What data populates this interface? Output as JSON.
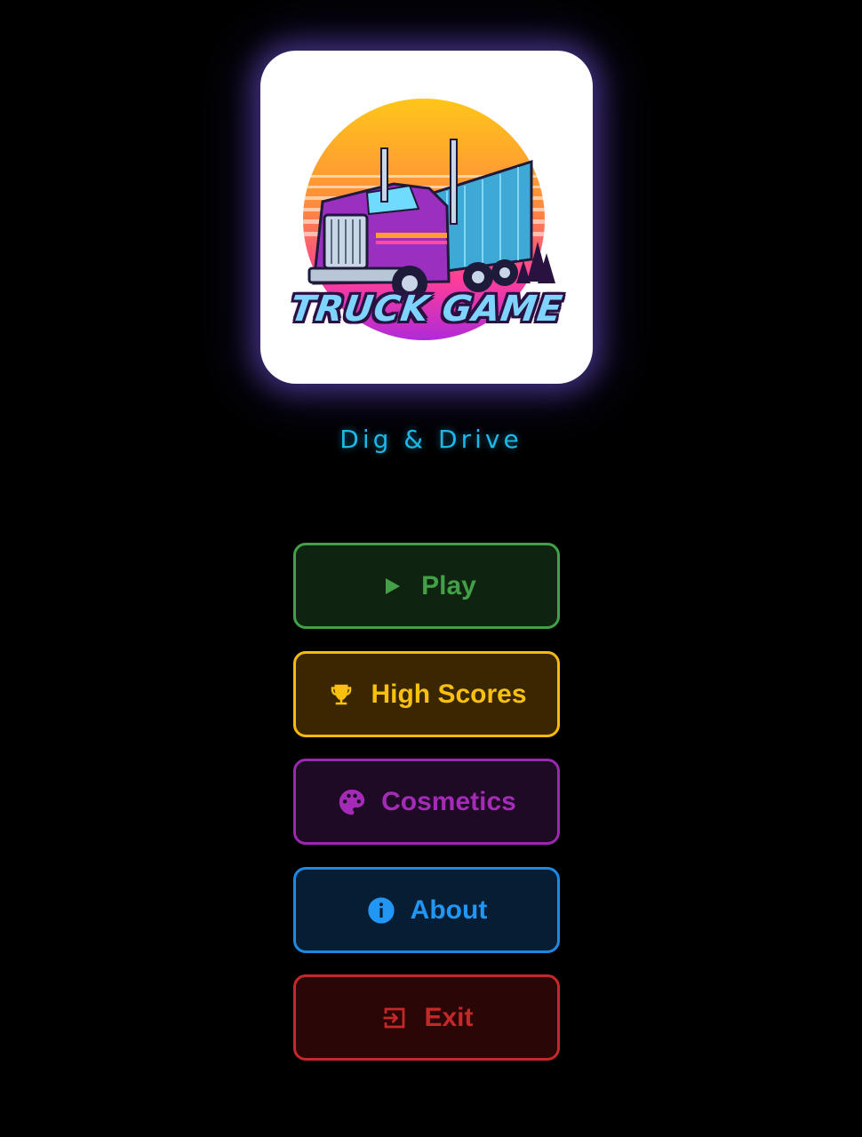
{
  "logo": {
    "title": "TRUCK GAME"
  },
  "subtitle": "Dig & Drive",
  "menu": {
    "play": {
      "label": "Play",
      "icon": "play-icon",
      "color": "#43a047"
    },
    "high_scores": {
      "label": "High Scores",
      "icon": "trophy-icon",
      "color": "#f9c00f"
    },
    "cosmetics": {
      "label": "Cosmetics",
      "icon": "palette-icon",
      "color": "#a62ab8"
    },
    "about": {
      "label": "About",
      "icon": "info-icon",
      "color": "#2196f3"
    },
    "exit": {
      "label": "Exit",
      "icon": "exit-icon",
      "color": "#c62828"
    }
  }
}
